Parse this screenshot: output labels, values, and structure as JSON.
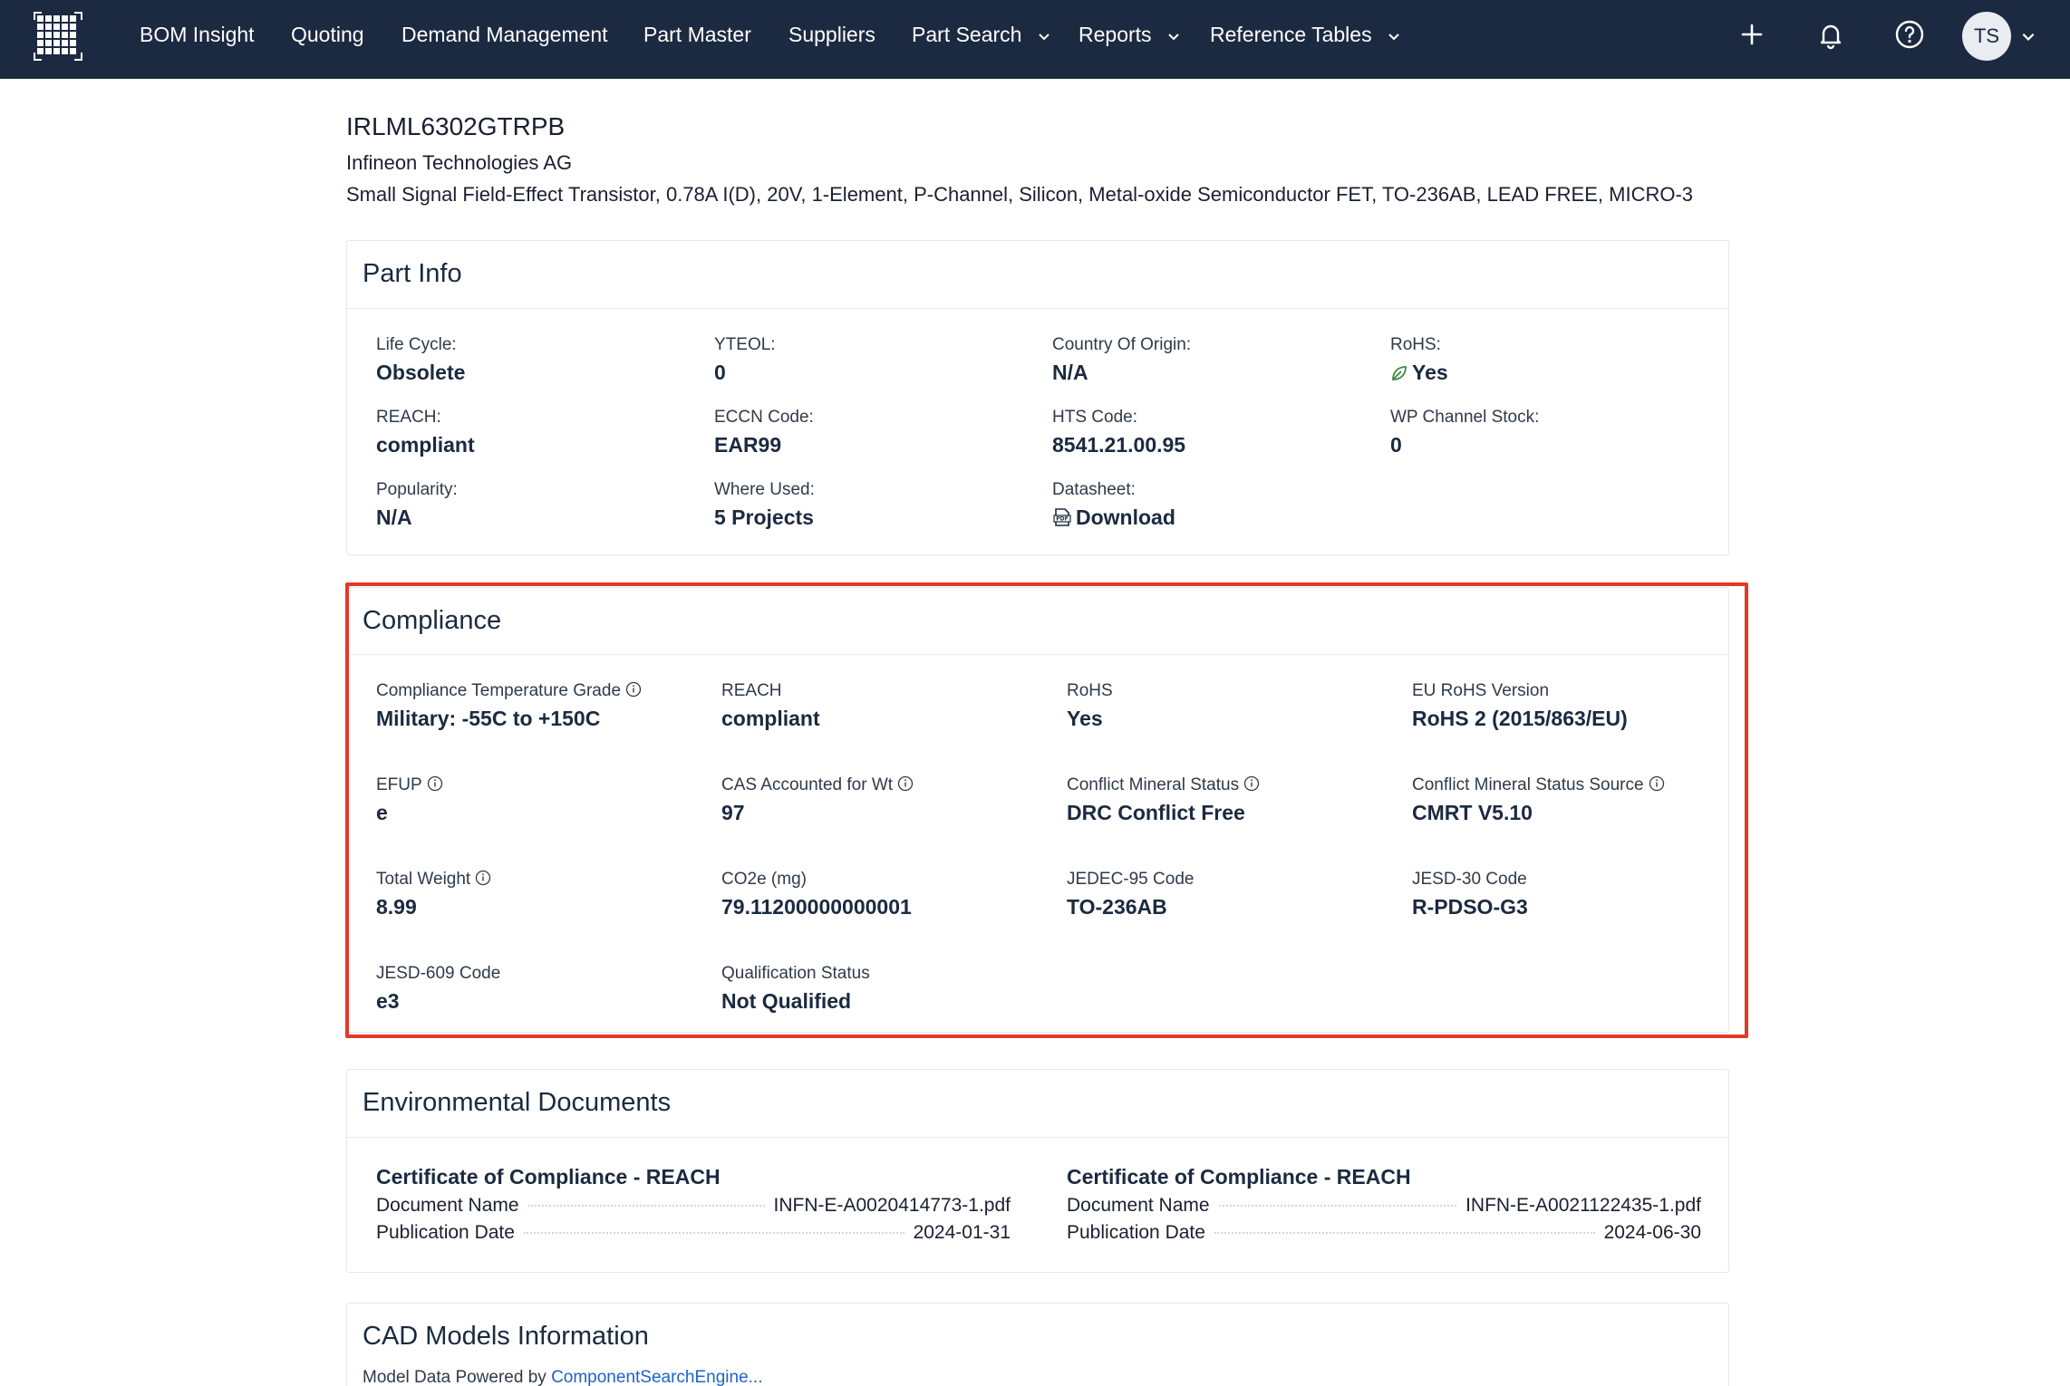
{
  "nav": {
    "items": [
      "BOM Insight",
      "Quoting",
      "Demand Management",
      "Part Master",
      "Suppliers",
      "Part Search",
      "Reports",
      "Reference Tables"
    ],
    "avatar_initials": "TS"
  },
  "header": {
    "part_number": "IRLML6302GTRPB",
    "manufacturer": "Infineon Technologies AG",
    "description": "Small Signal Field-Effect Transistor, 0.78A I(D), 20V, 1-Element, P-Channel, Silicon, Metal-oxide Semiconductor FET, TO-236AB, LEAD FREE, MICRO-3"
  },
  "part_info": {
    "title": "Part Info",
    "fields": [
      {
        "label": "Life Cycle:",
        "value": "Obsolete"
      },
      {
        "label": "YTEOL:",
        "value": "0"
      },
      {
        "label": "Country Of Origin:",
        "value": "N/A"
      },
      {
        "label": "RoHS:",
        "value": "Yes",
        "icon": "leaf-icon"
      },
      {
        "label": "REACH:",
        "value": "compliant"
      },
      {
        "label": "ECCN Code:",
        "value": "EAR99"
      },
      {
        "label": "HTS Code:",
        "value": "8541.21.00.95"
      },
      {
        "label": "WP Channel Stock:",
        "value": "0"
      },
      {
        "label": "Popularity:",
        "value": "N/A"
      },
      {
        "label": "Where Used:",
        "value": "5 Projects"
      },
      {
        "label": "Datasheet:",
        "value": "Download",
        "icon": "pdf-icon"
      }
    ]
  },
  "compliance": {
    "title": "Compliance",
    "fields": [
      {
        "label": "Compliance Temperature Grade",
        "value": "Military: -55C to +150C",
        "info": true
      },
      {
        "label": "REACH",
        "value": "compliant"
      },
      {
        "label": "RoHS",
        "value": "Yes"
      },
      {
        "label": "EU RoHS Version",
        "value": "RoHS 2 (2015/863/EU)"
      },
      {
        "label": "EFUP",
        "value": "e",
        "info": true
      },
      {
        "label": "CAS Accounted for Wt",
        "value": "97",
        "info": true
      },
      {
        "label": "Conflict Mineral Status",
        "value": "DRC Conflict Free",
        "info": true
      },
      {
        "label": "Conflict Mineral Status Source",
        "value": "CMRT V5.10",
        "info": true
      },
      {
        "label": "Total Weight",
        "value": "8.99",
        "info": true
      },
      {
        "label": "CO2e (mg)",
        "value": "79.11200000000001"
      },
      {
        "label": "JEDEC-95 Code",
        "value": "TO-236AB"
      },
      {
        "label": "JESD-30 Code",
        "value": "R-PDSO-G3"
      },
      {
        "label": "JESD-609 Code",
        "value": "e3"
      },
      {
        "label": "Qualification Status",
        "value": "Not Qualified"
      }
    ]
  },
  "env_docs": {
    "title": "Environmental Documents",
    "docs": [
      {
        "title": "Certificate of Compliance - REACH",
        "name_label": "Document Name",
        "name": "INFN-E-A0020414773-1.pdf",
        "date_label": "Publication Date",
        "date": "2024-01-31"
      },
      {
        "title": "Certificate of Compliance - REACH",
        "name_label": "Document Name",
        "name": "INFN-E-A0021122435-1.pdf",
        "date_label": "Publication Date",
        "date": "2024-06-30"
      }
    ]
  },
  "cad": {
    "title": "CAD Models Information",
    "powered_by": "Model Data Powered by",
    "link": "ComponentSearchEngine..."
  },
  "colors": {
    "nav_bg": "#1c2a41",
    "highlight": "#e33a27",
    "link": "#1f62c9",
    "leaf": "#3b8a3e"
  }
}
